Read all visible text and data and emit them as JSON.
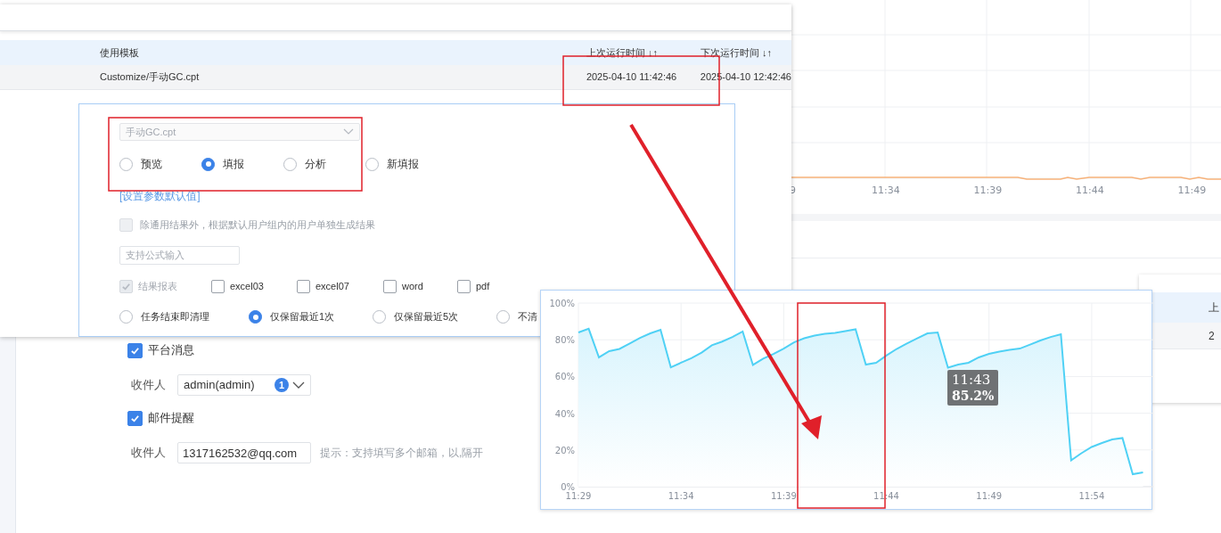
{
  "background_chart": {
    "x_labels": [
      "9",
      "11:34",
      "11:39",
      "11:44",
      "11:49"
    ]
  },
  "task_table": {
    "columns": [
      "使用模板",
      "上次运行时间 ↓↑",
      "下次运行时间 ↓↑"
    ],
    "rows": [
      {
        "cells": [
          "Customize/手动GC.cpt",
          "2025-04-10 11:42:46",
          "2025-04-10 12:42:46"
        ]
      }
    ]
  },
  "dialog": {
    "template_select": {
      "value": "手动GC.cpt",
      "disabled": true
    },
    "view_modes": [
      {
        "label": "预览",
        "selected": false
      },
      {
        "label": "填报",
        "selected": true
      },
      {
        "label": "分析",
        "selected": false
      },
      {
        "label": "新填报",
        "selected": false
      }
    ],
    "param_link": "[设置参数默认值]",
    "per_user_option": {
      "label": "除通用结果外，根据默认用户组内的用户单独生成结果",
      "checked": false,
      "disabled": true
    },
    "formula_field": {
      "placeholder": "支持公式输入"
    },
    "formats": [
      {
        "label": "结果报表",
        "checked": true,
        "disabled": true
      },
      {
        "label": "excel03",
        "checked": false,
        "disabled": false
      },
      {
        "label": "excel07",
        "checked": false,
        "disabled": false
      },
      {
        "label": "word",
        "checked": false,
        "disabled": false
      },
      {
        "label": "pdf",
        "checked": false,
        "disabled": false
      }
    ],
    "cleanup": [
      {
        "label": "任务结束即清理",
        "selected": false
      },
      {
        "label": "仅保留最近1次",
        "selected": true
      },
      {
        "label": "仅保留最近5次",
        "selected": false
      },
      {
        "label": "不清",
        "selected": false
      }
    ]
  },
  "notify": {
    "platform": {
      "label": "平台消息",
      "checked": true,
      "recipient_label": "收件人",
      "recipient": "admin(admin)",
      "count": "1"
    },
    "email": {
      "label": "邮件提醒",
      "checked": true,
      "recipient_label": "收件人",
      "recipient": "1317162532@qq.com",
      "hint": "提示：支持填写多个邮箱，以,隔开"
    }
  },
  "side_table": {
    "column_1": "上",
    "row_1": "2"
  },
  "memory_chart": {
    "chart_data": {
      "type": "area",
      "grid": true,
      "ylim": [
        0,
        100
      ],
      "categories": [
        "11:29",
        null,
        null,
        null,
        null,
        null,
        null,
        null,
        null,
        null,
        "11:34",
        null,
        null,
        null,
        null,
        null,
        null,
        null,
        null,
        null,
        "11:39",
        null,
        null,
        null,
        null,
        null,
        null,
        null,
        null,
        null,
        "11:44",
        null,
        null,
        null,
        null,
        null,
        null,
        null,
        null,
        null,
        "11:49",
        null,
        null,
        null,
        null,
        null,
        null,
        null,
        null,
        null,
        "11:54",
        null,
        null,
        null,
        null,
        null
      ],
      "series": [
        {
          "color": "#4fd1f5",
          "values": [
            84,
            86,
            70.4,
            73.8,
            75,
            78,
            81,
            83.5,
            85.4,
            65,
            67.5,
            70,
            73,
            77,
            79,
            81.5,
            84.5,
            66.3,
            69.7,
            72.3,
            75.2,
            78.6,
            80.8,
            82.3,
            83.3,
            83.7,
            84.7,
            85.7,
            66.5,
            67.5,
            71.4,
            75,
            78,
            80.8,
            83.5,
            84,
            64.8,
            66.5,
            67.5,
            70.4,
            72.3,
            73.5,
            74.5,
            75.2,
            77.4,
            79.6,
            81.5,
            83,
            14.3,
            18.2,
            21.6,
            23.8,
            25.7,
            26.5,
            6.8,
            7.8
          ]
        }
      ],
      "yticks": [
        {
          "value": 0,
          "label": "0%"
        },
        {
          "value": 20,
          "label": "20%"
        },
        {
          "value": 40,
          "label": "40%"
        },
        {
          "value": 60,
          "label": "60%"
        },
        {
          "value": 80,
          "label": "80%"
        },
        {
          "value": 100,
          "label": "100%"
        }
      ],
      "annotations": [
        {
          "text": "11:43"
        },
        {
          "text": "85.2%"
        }
      ]
    }
  }
}
